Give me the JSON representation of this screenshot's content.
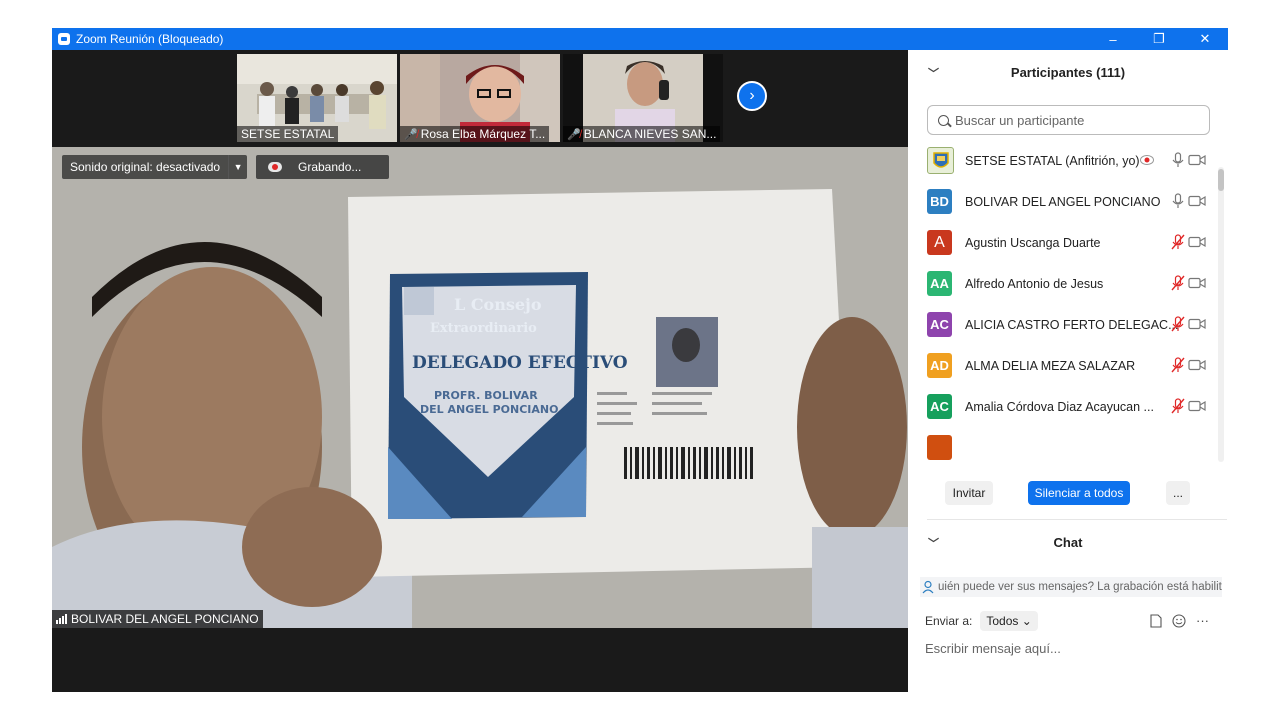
{
  "window": {
    "title": "Zoom Reunión (Bloqueado)",
    "minimize": "–",
    "restore": "❐",
    "close": "✕"
  },
  "thumbnails": [
    {
      "name": "SETSE ESTATAL",
      "muted": false
    },
    {
      "name": "Rosa Elba Márquez T...",
      "muted": true
    },
    {
      "name": "BLANCA NIEVES  SAN...",
      "muted": true
    }
  ],
  "next_page_icon": "chevron-right-icon",
  "main_video": {
    "original_sound_label": "Sonido original: desactivado",
    "recording_label": "Grabando...",
    "speaker_name": "BOLIVAR DEL ANGEL PONCIANO",
    "card": {
      "line1": "L Consejo",
      "line2": "Extraordinario",
      "line3": "DELEGADO EFECTIVO",
      "line4": "PROFR. BOLIVAR",
      "line5": "DEL ANGEL PONCIANO"
    }
  },
  "participants": {
    "header": "Participantes (111)",
    "search_placeholder": "Buscar un participante",
    "list": [
      {
        "initials": "",
        "name": "SETSE ESTATAL (Anfitrión, yo)",
        "color": "#d8e8c0",
        "mic": "on",
        "recording": true
      },
      {
        "initials": "BD",
        "name": "BOLIVAR DEL ANGEL PONCIANO",
        "color": "#2d7fc1",
        "mic": "on",
        "recording": false
      },
      {
        "initials": "A",
        "name": "Agustin Uscanga Duarte",
        "color": "#c9381e",
        "mic": "muted",
        "recording": false
      },
      {
        "initials": "AA",
        "name": "Alfredo Antonio de Jesus",
        "color": "#2bb673",
        "mic": "muted",
        "recording": false
      },
      {
        "initials": "AC",
        "name": "ALICIA CASTRO FERTO DELEGAC...",
        "color": "#8e44ad",
        "mic": "muted",
        "recording": false
      },
      {
        "initials": "AD",
        "name": "ALMA DELIA MEZA SALAZAR",
        "color": "#f0a020",
        "mic": "muted",
        "recording": false
      },
      {
        "initials": "AC",
        "name": "Amalia Córdova Diaz Acayucan ...",
        "color": "#16a05d",
        "mic": "muted",
        "recording": false
      }
    ],
    "invite": "Invitar",
    "mute_all": "Silenciar a todos",
    "more": "..."
  },
  "chat": {
    "header": "Chat",
    "notice": "uién puede ver sus mensajes? La grabación está habilit",
    "send_to_label": "Enviar a:",
    "send_to_value": "Todos",
    "input_placeholder": "Escribir mensaje aquí..."
  }
}
